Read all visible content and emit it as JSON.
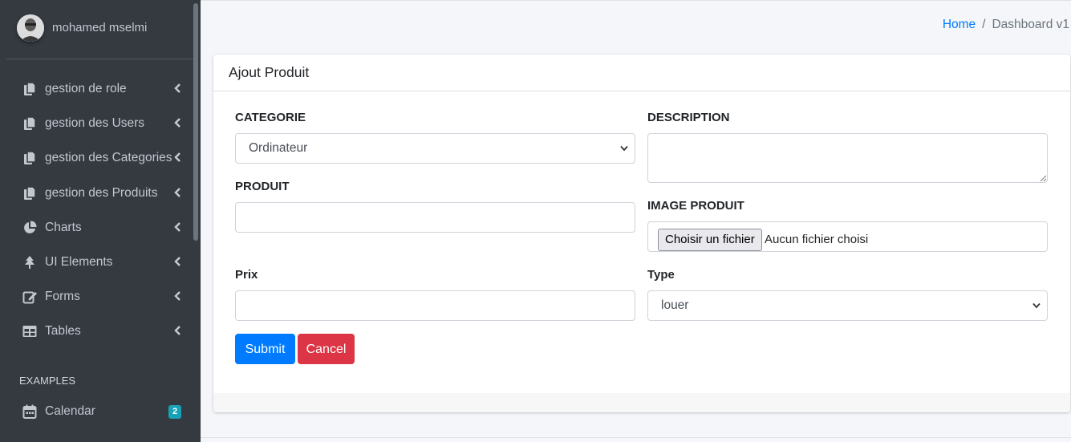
{
  "user": {
    "name": "mohamed mselmi"
  },
  "sidebar": {
    "items": [
      {
        "label": "gestion de role",
        "icon": "copy-icon"
      },
      {
        "label": "gestion des Users",
        "icon": "copy-icon"
      },
      {
        "label": "gestion des Categories",
        "icon": "copy-icon"
      },
      {
        "label": "gestion des Produits",
        "icon": "copy-icon"
      },
      {
        "label": "Charts",
        "icon": "pie-chart-icon"
      },
      {
        "label": "UI Elements",
        "icon": "tree-icon"
      },
      {
        "label": "Forms",
        "icon": "edit-icon"
      },
      {
        "label": "Tables",
        "icon": "table-icon"
      }
    ],
    "section_header": "EXAMPLES",
    "examples": [
      {
        "label": "Calendar",
        "icon": "calendar-icon",
        "badge": "2"
      }
    ]
  },
  "breadcrumb": {
    "home": "Home",
    "separator": "/",
    "current": "Dashboard v1"
  },
  "card": {
    "title": "Ajout Produit",
    "fields": {
      "categorie": {
        "label": "CATEGORIE",
        "value": "Ordinateur"
      },
      "produit": {
        "label": "PRODUIT",
        "value": ""
      },
      "prix": {
        "label": "Prix",
        "value": ""
      },
      "description": {
        "label": "DESCRIPTION",
        "value": ""
      },
      "image": {
        "label": "IMAGE PRODUIT",
        "button": "Choisir un fichier",
        "status": "Aucun fichier choisi"
      },
      "type": {
        "label": "Type",
        "value": "louer"
      }
    },
    "buttons": {
      "submit": "Submit",
      "cancel": "Cancel"
    }
  },
  "colors": {
    "sidebar": "#343a40",
    "primary": "#007bff",
    "danger": "#dc3545",
    "badge": "#17a2b8"
  }
}
